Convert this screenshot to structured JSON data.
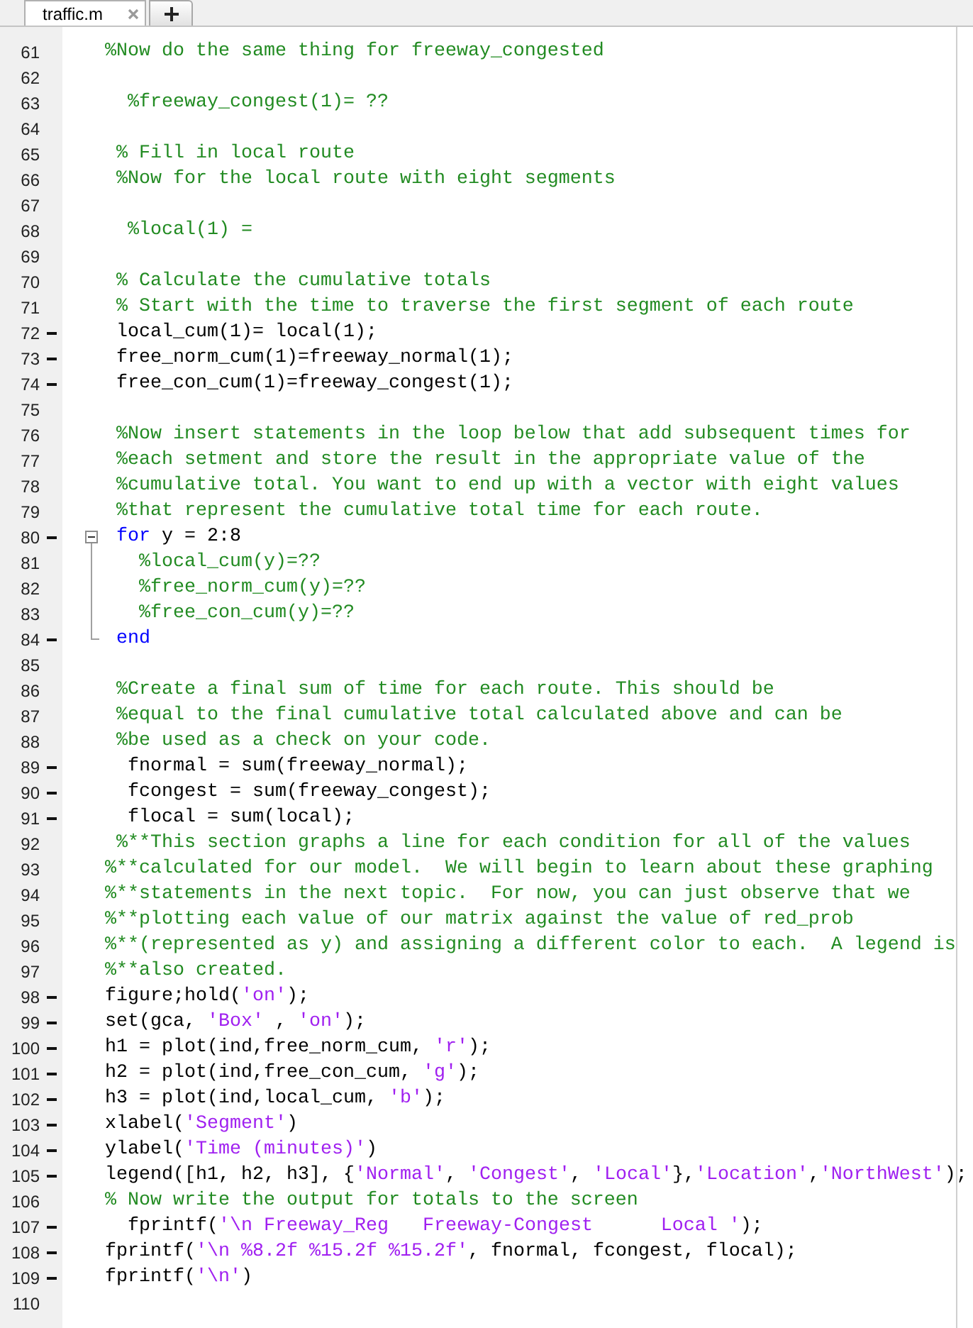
{
  "tabs": [
    {
      "label": "traffic.m",
      "selected": true
    }
  ],
  "lines": [
    {
      "number": "61",
      "executable": false,
      "segments": [
        {
          "kind": "comment",
          "text": "%Now do the same thing for freeway_congested"
        }
      ]
    },
    {
      "number": "62",
      "executable": false
    },
    {
      "number": "63",
      "executable": false,
      "segments": [
        {
          "kind": "comment",
          "text": "  %freeway_congest(1)= ??"
        }
      ]
    },
    {
      "number": "64",
      "executable": false
    },
    {
      "number": "65",
      "executable": false,
      "segments": [
        {
          "kind": "comment",
          "text": " % Fill in local route"
        }
      ]
    },
    {
      "number": "66",
      "executable": false,
      "segments": [
        {
          "kind": "comment",
          "text": " %Now for the local route with eight segments"
        }
      ]
    },
    {
      "number": "67",
      "executable": false
    },
    {
      "number": "68",
      "executable": false,
      "segments": [
        {
          "kind": "comment",
          "text": "  %local(1) ="
        }
      ]
    },
    {
      "number": "69",
      "executable": false
    },
    {
      "number": "70",
      "executable": false,
      "segments": [
        {
          "kind": "comment",
          "text": " % Calculate the cumulative totals"
        }
      ]
    },
    {
      "number": "71",
      "executable": false,
      "segments": [
        {
          "kind": "comment",
          "text": " % Start with the time to traverse the first segment of each route"
        }
      ]
    },
    {
      "number": "72",
      "executable": true,
      "segments": [
        {
          "kind": "code",
          "text": " local_cum(1)= local(1);"
        }
      ]
    },
    {
      "number": "73",
      "executable": true,
      "segments": [
        {
          "kind": "code",
          "text": " free_norm_cum(1)=freeway_normal(1);"
        }
      ]
    },
    {
      "number": "74",
      "executable": true,
      "segments": [
        {
          "kind": "code",
          "text": " free_con_cum(1)=freeway_congest(1);"
        }
      ]
    },
    {
      "number": "75",
      "executable": false
    },
    {
      "number": "76",
      "executable": false,
      "segments": [
        {
          "kind": "comment",
          "text": " %Now insert statements in the loop below that add subsequent times for"
        }
      ]
    },
    {
      "number": "77",
      "executable": false,
      "segments": [
        {
          "kind": "comment",
          "text": " %each setment and store the result in the appropriate value of the"
        }
      ]
    },
    {
      "number": "78",
      "executable": false,
      "segments": [
        {
          "kind": "comment",
          "text": " %cumulative total. You want to end up with a vector with eight values"
        }
      ]
    },
    {
      "number": "79",
      "executable": false,
      "segments": [
        {
          "kind": "comment",
          "text": " %that represent the cumulative total time for each route."
        }
      ]
    },
    {
      "number": "80",
      "executable": true,
      "expanded": true,
      "segments": [
        {
          "kind": "keyword",
          "text": " for"
        },
        {
          "kind": "code",
          "text": " y = 2:8"
        }
      ],
      "children": [
        {
          "number": "81",
          "executable": false,
          "segments": [
            {
              "kind": "comment",
              "text": "   %local_cum(y)=??"
            }
          ]
        },
        {
          "number": "82",
          "executable": false,
          "segments": [
            {
              "kind": "comment",
              "text": "   %free_norm_cum(y)=??"
            }
          ]
        },
        {
          "number": "83",
          "executable": false,
          "segments": [
            {
              "kind": "comment",
              "text": "   %free_con_cum(y)=??"
            }
          ]
        },
        {
          "number": "84",
          "executable": true,
          "segments": [
            {
              "kind": "keyword",
              "text": " end"
            }
          ]
        }
      ]
    },
    {
      "number": "85",
      "executable": false
    },
    {
      "number": "86",
      "executable": false,
      "segments": [
        {
          "kind": "comment",
          "text": " %Create a final sum of time for each route. This should be"
        }
      ]
    },
    {
      "number": "87",
      "executable": false,
      "segments": [
        {
          "kind": "comment",
          "text": " %equal to the final cumulative total calculated above and can be"
        }
      ]
    },
    {
      "number": "88",
      "executable": false,
      "segments": [
        {
          "kind": "comment",
          "text": " %be used as a check on your code."
        }
      ]
    },
    {
      "number": "89",
      "executable": true,
      "segments": [
        {
          "kind": "code",
          "text": "  fnormal = sum(freeway_normal);"
        }
      ]
    },
    {
      "number": "90",
      "executable": true,
      "segments": [
        {
          "kind": "code",
          "text": "  fcongest = sum(freeway_congest);"
        }
      ]
    },
    {
      "number": "91",
      "executable": true,
      "segments": [
        {
          "kind": "code",
          "text": "  flocal = sum(local);"
        }
      ]
    },
    {
      "number": "92",
      "executable": false,
      "segments": [
        {
          "kind": "comment",
          "text": " %**This section graphs a line for each condition for all of the values"
        }
      ]
    },
    {
      "number": "93",
      "executable": false,
      "segments": [
        {
          "kind": "comment",
          "text": "%**calculated for our model.  We will begin to learn about these graphing"
        }
      ]
    },
    {
      "number": "94",
      "executable": false,
      "segments": [
        {
          "kind": "comment",
          "text": "%**statements in the next topic.  For now, you can just observe that we"
        }
      ]
    },
    {
      "number": "95",
      "executable": false,
      "segments": [
        {
          "kind": "comment",
          "text": "%**plotting each value of our matrix against the value of red_prob"
        }
      ]
    },
    {
      "number": "96",
      "executable": false,
      "segments": [
        {
          "kind": "comment",
          "text": "%**(represented as y) and assigning a different color to each.  A legend is"
        }
      ]
    },
    {
      "number": "97",
      "executable": false,
      "segments": [
        {
          "kind": "comment",
          "text": "%**also created."
        }
      ]
    },
    {
      "number": "98",
      "executable": true,
      "segments": [
        {
          "kind": "code",
          "text": "figure;hold("
        },
        {
          "kind": "string",
          "text": "'on'"
        },
        {
          "kind": "code",
          "text": ");"
        }
      ]
    },
    {
      "number": "99",
      "executable": true,
      "segments": [
        {
          "kind": "code",
          "text": "set(gca, "
        },
        {
          "kind": "string",
          "text": "'Box'"
        },
        {
          "kind": "code",
          "text": " , "
        },
        {
          "kind": "string",
          "text": "'on'"
        },
        {
          "kind": "code",
          "text": ");"
        }
      ]
    },
    {
      "number": "100",
      "executable": true,
      "segments": [
        {
          "kind": "code",
          "text": "h1 = plot(ind,free_norm_cum, "
        },
        {
          "kind": "string",
          "text": "'r'"
        },
        {
          "kind": "code",
          "text": ");"
        }
      ]
    },
    {
      "number": "101",
      "executable": true,
      "segments": [
        {
          "kind": "code",
          "text": "h2 = plot(ind,free_con_cum, "
        },
        {
          "kind": "string",
          "text": "'g'"
        },
        {
          "kind": "code",
          "text": ");"
        }
      ]
    },
    {
      "number": "102",
      "executable": true,
      "segments": [
        {
          "kind": "code",
          "text": "h3 = plot(ind,local_cum, "
        },
        {
          "kind": "string",
          "text": "'b'"
        },
        {
          "kind": "code",
          "text": ");"
        }
      ]
    },
    {
      "number": "103",
      "executable": true,
      "segments": [
        {
          "kind": "code",
          "text": "xlabel("
        },
        {
          "kind": "string",
          "text": "'Segment'"
        },
        {
          "kind": "code",
          "text": ")"
        }
      ]
    },
    {
      "number": "104",
      "executable": true,
      "segments": [
        {
          "kind": "code",
          "text": "ylabel("
        },
        {
          "kind": "string",
          "text": "'Time (minutes)'"
        },
        {
          "kind": "code",
          "text": ")"
        }
      ]
    },
    {
      "number": "105",
      "executable": true,
      "segments": [
        {
          "kind": "code",
          "text": "legend([h1, h2, h3], {"
        },
        {
          "kind": "string",
          "text": "'Normal'"
        },
        {
          "kind": "code",
          "text": ", "
        },
        {
          "kind": "string",
          "text": "'Congest'"
        },
        {
          "kind": "code",
          "text": ", "
        },
        {
          "kind": "string",
          "text": "'Local'"
        },
        {
          "kind": "code",
          "text": "},"
        },
        {
          "kind": "string",
          "text": "'Location'"
        },
        {
          "kind": "code",
          "text": ","
        },
        {
          "kind": "string",
          "text": "'NorthWest'"
        },
        {
          "kind": "code",
          "text": ");"
        }
      ]
    },
    {
      "number": "106",
      "executable": false,
      "segments": [
        {
          "kind": "comment",
          "text": "% Now write the output for totals to the screen"
        }
      ]
    },
    {
      "number": "107",
      "executable": true,
      "segments": [
        {
          "kind": "code",
          "text": "  fprintf("
        },
        {
          "kind": "string",
          "text": "'\\n Freeway_Reg   Freeway-Congest      Local '"
        },
        {
          "kind": "code",
          "text": ");"
        }
      ]
    },
    {
      "number": "108",
      "executable": true,
      "segments": [
        {
          "kind": "code",
          "text": "fprintf("
        },
        {
          "kind": "string",
          "text": "'\\n %8.2f %15.2f %15.2f'"
        },
        {
          "kind": "code",
          "text": ", fnormal, fcongest, flocal);"
        }
      ]
    },
    {
      "number": "109",
      "executable": true,
      "segments": [
        {
          "kind": "code",
          "text": "fprintf("
        },
        {
          "kind": "string",
          "text": "'\\n'"
        },
        {
          "kind": "code",
          "text": ")"
        }
      ]
    },
    {
      "number": "110",
      "executable": false
    }
  ]
}
